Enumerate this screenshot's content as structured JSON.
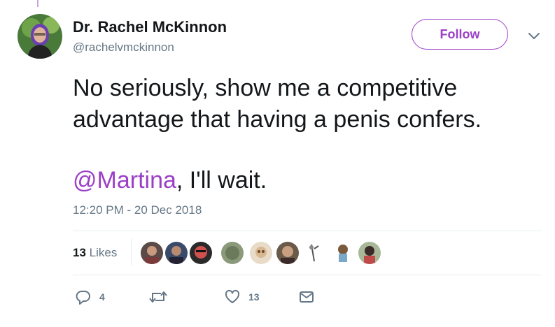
{
  "author": {
    "name": "Dr. Rachel McKinnon",
    "handle": "@rachelvmckinnon"
  },
  "follow_label": "Follow",
  "tweet": {
    "line1": "No seriously, show me a competitive",
    "line2": "advantage that having a penis confers.",
    "mention": "@Martina",
    "line3_rest": ", I'll wait."
  },
  "timestamp": "12:20 PM - 20 Dec 2018",
  "likes": {
    "count": "13",
    "label": "Likes"
  },
  "actions": {
    "reply_count": "4",
    "retweet_count": "",
    "like_count": "13"
  },
  "colors": {
    "accent": "#9b3fc7",
    "secondary_text": "#657786"
  },
  "icons": [
    "reply-icon",
    "retweet-icon",
    "heart-icon",
    "envelope-icon",
    "chevron-down-icon"
  ]
}
